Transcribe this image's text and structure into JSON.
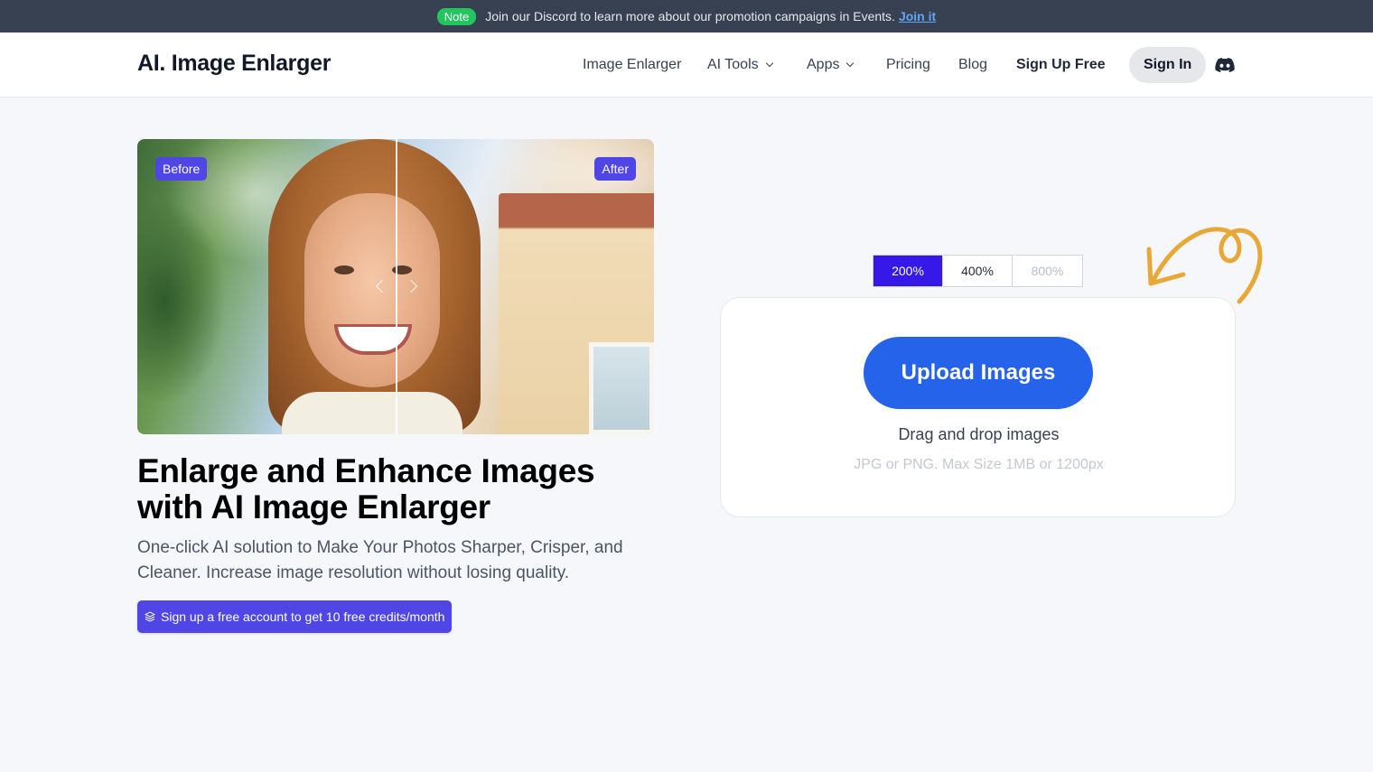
{
  "announcement": {
    "badge": "Note",
    "message": "Join our Discord to learn more about our promotion campaigns in Events.",
    "link": "Join it"
  },
  "header": {
    "logo": "AI. Image Enlarger",
    "nav": {
      "image_enlarger": "Image Enlarger",
      "ai_tools": "AI Tools",
      "apps": "Apps",
      "pricing": "Pricing",
      "blog": "Blog",
      "sign_up": "Sign Up Free",
      "sign_in": "Sign In"
    },
    "discord_icon": "discord-icon"
  },
  "hero": {
    "before_label": "Before",
    "after_label": "After",
    "headline_line1": "Enlarge and Enhance Images",
    "headline_line2": "with AI Image Enlarger",
    "subhead": "One-click AI solution to Make Your Photos Sharper, Crisper, and Cleaner. Increase image resolution without losing quality.",
    "promo": "Sign up a free account to get 10 free credits/month"
  },
  "upload": {
    "scales": [
      {
        "label": "200%",
        "state": "selected"
      },
      {
        "label": "400%",
        "state": "enabled"
      },
      {
        "label": "800%",
        "state": "disabled"
      }
    ],
    "button": "Upload Images",
    "drag_text": "Drag and drop images",
    "hint": "JPG or PNG. Max Size 1MB or 1200px"
  },
  "colors": {
    "accent": "#4f46e5",
    "upload_button": "#2563eb",
    "selected_scale": "#3618e8",
    "note_badge": "#22c55e",
    "doodle_arrow": "#e8a838"
  }
}
